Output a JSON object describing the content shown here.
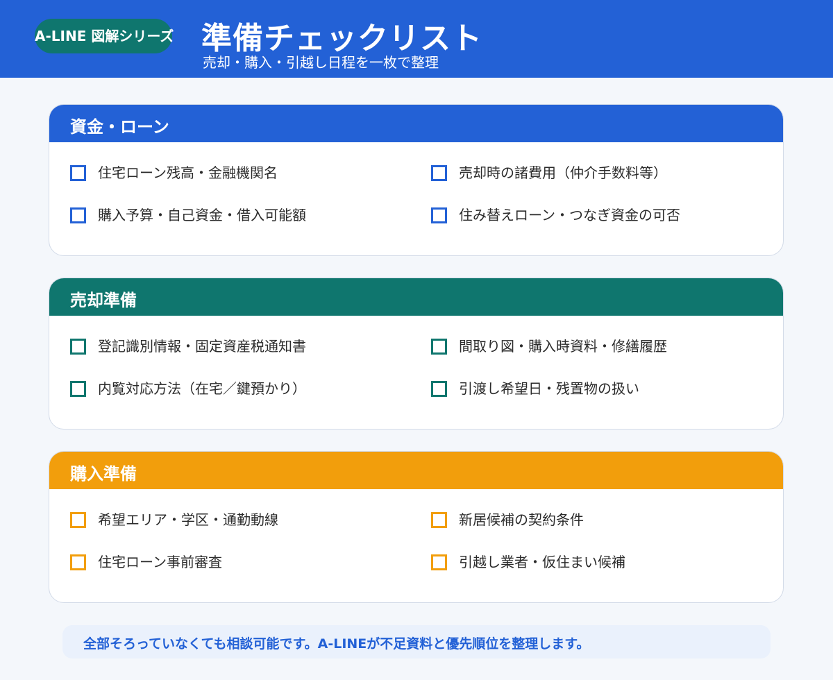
{
  "header": {
    "series_badge": "A-LINE 図解シリーズ",
    "title": "準備チェックリスト",
    "subtitle": "売却・購入・引越し日程を一枚で整理",
    "background_color": "#2361d6",
    "badge_color": "#0f766e"
  },
  "sections": [
    {
      "title": "資金・ローン",
      "accent_color": "#2361d6",
      "items": [
        {
          "label": "住宅ローン残高・金融機関名",
          "checked": false
        },
        {
          "label": "売却時の諸費用（仲介手数料等）",
          "checked": false
        },
        {
          "label": "購入予算・自己資金・借入可能額",
          "checked": false
        },
        {
          "label": "住み替えローン・つなぎ資金の可否",
          "checked": false
        }
      ]
    },
    {
      "title": "売却準備",
      "accent_color": "#0f766e",
      "items": [
        {
          "label": "登記識別情報・固定資産税通知書",
          "checked": false
        },
        {
          "label": "間取り図・購入時資料・修繕履歴",
          "checked": false
        },
        {
          "label": "内覧対応方法（在宅／鍵預かり）",
          "checked": false
        },
        {
          "label": "引渡し希望日・残置物の扱い",
          "checked": false
        }
      ]
    },
    {
      "title": "購入準備",
      "accent_color": "#f29e0c",
      "items": [
        {
          "label": "希望エリア・学区・通勤動線",
          "checked": false
        },
        {
          "label": "新居候補の契約条件",
          "checked": false
        },
        {
          "label": "住宅ローン事前審査",
          "checked": false
        },
        {
          "label": "引越し業者・仮住まい候補",
          "checked": false
        }
      ]
    }
  ],
  "footer_note": "全部そろっていなくても相談可能です。A-LINEが不足資料と優先順位を整理します。"
}
